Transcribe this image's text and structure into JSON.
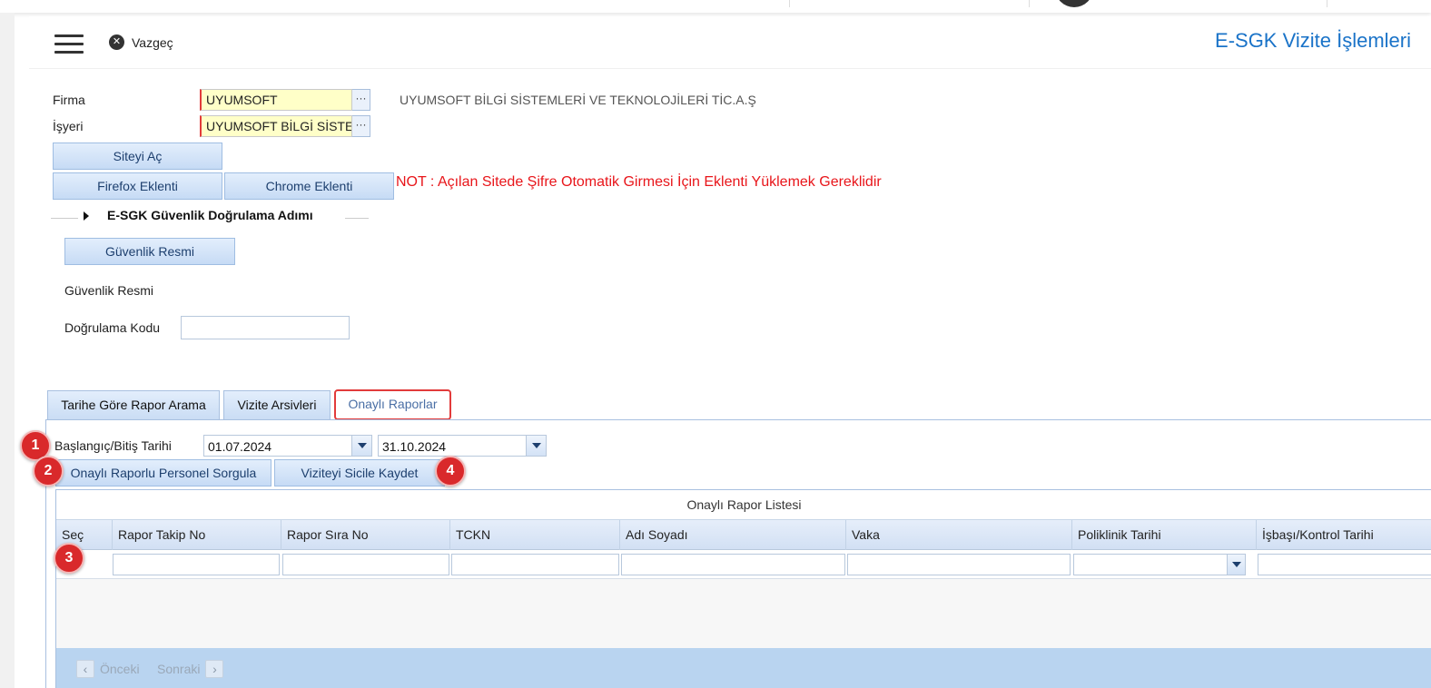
{
  "header": {
    "cancel_label": "Vazgeç",
    "title": "E-SGK Vizite İşlemleri"
  },
  "form": {
    "firma_label": "Firma",
    "firma_value": "UYUMSOFT",
    "isyeri_label": "İşyeri",
    "isyeri_value": "UYUMSOFT BİLGİ SİSTE",
    "lookup_button": "···",
    "company_name": "UYUMSOFT BİLGİ SİSTEMLERİ VE TEKNOLOJİLERİ TİC.A.Ş",
    "open_site_button": "Siteyi Aç",
    "firefox_button": "Firefox Eklenti",
    "chrome_button": "Chrome Eklenti",
    "note": "NOT : Açılan Sitede Şifre Otomatik Girmesi İçin Eklenti Yüklemek Gereklidir"
  },
  "security": {
    "section_title": "E-SGK Güvenlik Doğrulama Adımı",
    "image_button": "Güvenlik Resmi",
    "image_label": "Güvenlik Resmi",
    "code_label": "Doğrulama Kodu",
    "code_value": ""
  },
  "tabs": [
    {
      "label": "Tarihe Göre Rapor Arama"
    },
    {
      "label": "Vizite Arsivleri"
    },
    {
      "label": "Onaylı Raporlar",
      "active": true
    }
  ],
  "approved": {
    "date_label": "Başlangıç/Bitiş Tarihi",
    "start_date": "01.07.2024",
    "end_date": "31.10.2024",
    "query_button": "Onaylı Raporlu Personel Sorgula",
    "save_button": "Viziteyi Sicile Kaydet",
    "badges": [
      "1",
      "2",
      "3",
      "4"
    ]
  },
  "grid": {
    "title": "Onaylı Rapor Listesi",
    "columns": [
      "Seç",
      "Rapor Takip No",
      "Rapor Sıra No",
      "TCKN",
      "Adı Soyadı",
      "Vaka",
      "Poliklinik Tarihi",
      "İşbaşı/Kontrol Tarihi"
    ],
    "pager_prev": "Önceki",
    "pager_next": "Sonraki"
  },
  "colors": {
    "accent": "#1a73c8",
    "note_red": "#e8151a",
    "badge_red": "#d9292b",
    "button_blue": "#c6dbf5"
  }
}
